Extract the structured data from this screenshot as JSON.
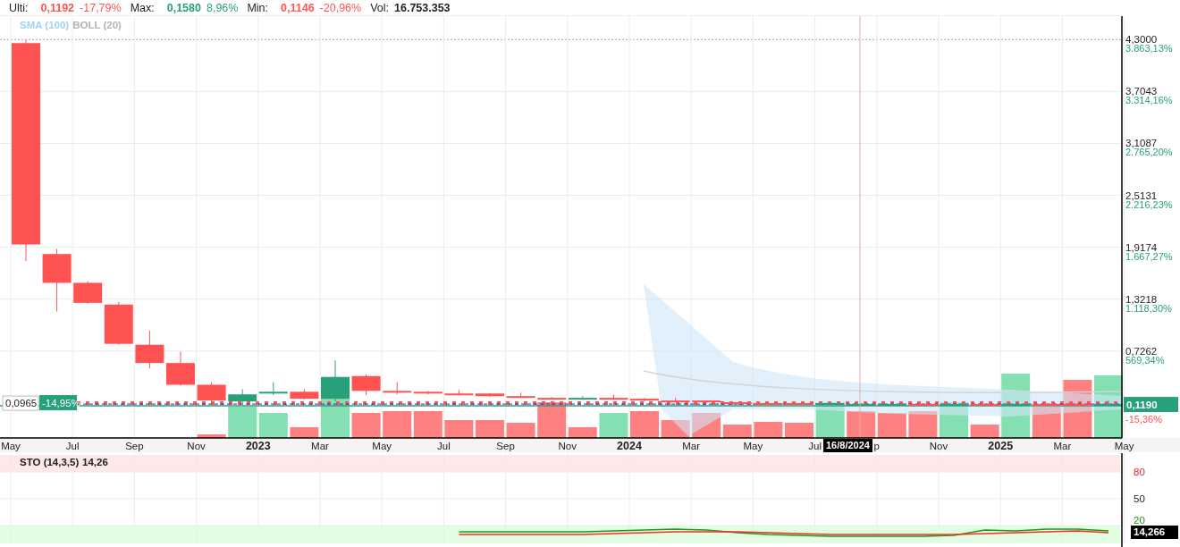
{
  "stats": [
    {
      "label": "Ulti:",
      "value": "0,1192",
      "change": "-17,79%",
      "color": "#ff5252"
    },
    {
      "label": "Max:",
      "value": "0,1580",
      "change": "8,96%",
      "color": "#26a17b"
    },
    {
      "label": "Min:",
      "value": "0,1146",
      "change": "-20,96%",
      "color": "#ff5252"
    }
  ],
  "volume": {
    "label": "Vol:",
    "value": "16.753.353"
  },
  "indicators": [
    {
      "label": "SMA (100)",
      "color": "#9fd3f5"
    },
    {
      "label": "BOLL (20)",
      "color": "#b4b4b4"
    }
  ],
  "price_chart": {
    "price_labels": [
      "4,3000",
      "3,7043",
      "3,1087",
      "2,5131",
      "1,9174",
      "1,3218",
      "0,7262"
    ],
    "percent_labels": [
      "3.863,13%",
      "3.314,16%",
      "2.765,20%",
      "2.216,23%",
      "1.667,27%",
      "1.118,30%",
      "569,34%"
    ],
    "time_labels": [
      {
        "label": "May",
        "kind": "month"
      },
      {
        "label": "Jul",
        "kind": "month"
      },
      {
        "label": "Sep",
        "kind": "month"
      },
      {
        "label": "Nov",
        "kind": "month"
      },
      {
        "label": "2023",
        "kind": "year"
      },
      {
        "label": "Mar",
        "kind": "month"
      },
      {
        "label": "May",
        "kind": "month"
      },
      {
        "label": "Jul",
        "kind": "month"
      },
      {
        "label": "Sep",
        "kind": "month"
      },
      {
        "label": "Nov",
        "kind": "month"
      },
      {
        "label": "2024",
        "kind": "year"
      },
      {
        "label": "Mar",
        "kind": "month"
      },
      {
        "label": "May",
        "kind": "month"
      },
      {
        "label": "Jul",
        "kind": "month"
      },
      {
        "label": "p",
        "kind": "month"
      },
      {
        "label": "Nov",
        "kind": "month"
      },
      {
        "label": "2025",
        "kind": "year"
      },
      {
        "label": "Mar",
        "kind": "month"
      },
      {
        "label": "May",
        "kind": "month"
      }
    ],
    "last_price": {
      "label": "0,1190",
      "change": "-15,36%"
    },
    "reference_price": {
      "label": "0,0965",
      "change": "-14,95%"
    },
    "crosshair": {
      "date": "16/8/2024"
    }
  },
  "stochastic": {
    "title": "STO (14,3,5)",
    "value": "14,26",
    "badge": "14,266",
    "chart_data": {
      "type": "line",
      "grid": true,
      "ylim": [
        0,
        101
      ],
      "yticks": [
        80,
        50,
        20
      ],
      "series": [
        {
          "color": "#1a9c1a",
          "values": [
            13,
            13,
            13,
            13,
            13,
            14,
            15,
            16,
            15,
            12,
            10,
            9,
            8,
            8,
            8,
            8,
            9,
            15,
            14,
            16,
            16,
            14
          ]
        },
        {
          "color": "#ff2a2a",
          "values": [
            10,
            10,
            10,
            10,
            10,
            11,
            12,
            13,
            13,
            13,
            12,
            11,
            10,
            10,
            10,
            10,
            10,
            11,
            12,
            13,
            14,
            12
          ]
        }
      ]
    }
  }
}
